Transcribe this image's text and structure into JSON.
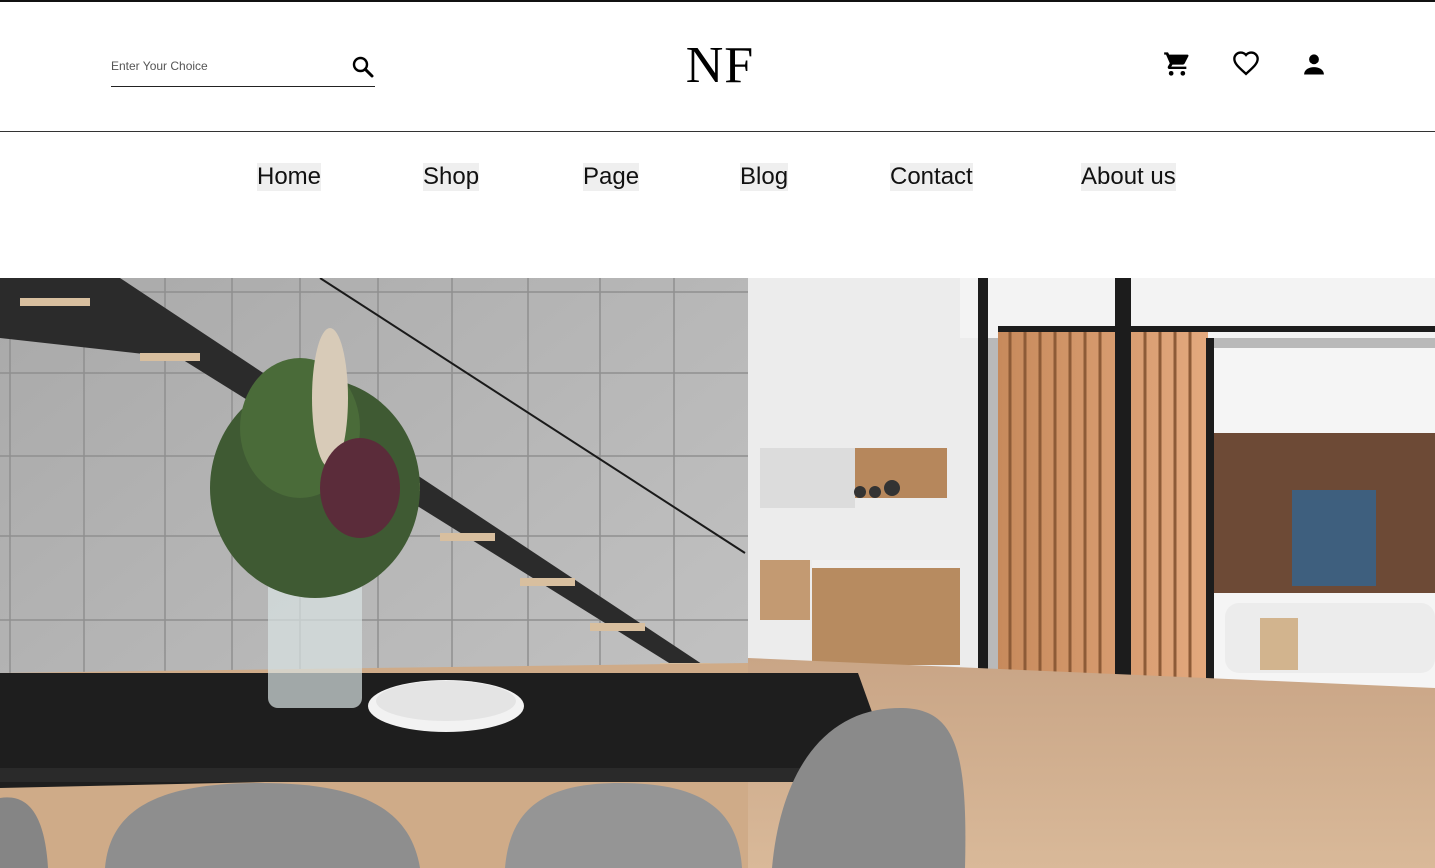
{
  "header": {
    "search": {
      "placeholder": "Enter Your Choice",
      "icon": "search-icon"
    },
    "logo": "NF",
    "icons": [
      "cart-icon",
      "heart-icon",
      "user-icon"
    ]
  },
  "nav": {
    "items": [
      {
        "label": "Home"
      },
      {
        "label": "Shop"
      },
      {
        "label": "Page"
      },
      {
        "label": "Blog"
      },
      {
        "label": "Contact"
      },
      {
        "label": "About us"
      }
    ]
  },
  "hero": {
    "image": "interior-dining-room-photo"
  },
  "colors": {
    "accent": "#000000",
    "nav_bg": "#efefef",
    "divider": "#333333"
  }
}
